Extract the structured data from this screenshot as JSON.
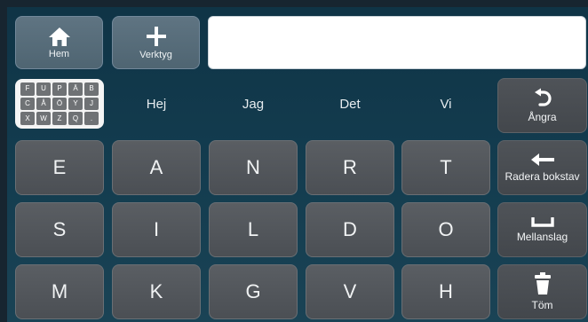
{
  "toolbar": {
    "home_label": "Hem",
    "tools_label": "Verktyg"
  },
  "message_field": {
    "value": ""
  },
  "keyboard_selector": {
    "letters": [
      "F",
      "U",
      "P",
      "Ä",
      "B",
      "C",
      "Å",
      "Ö",
      "Y",
      "J",
      "X",
      "W",
      "Z",
      "Q",
      "."
    ]
  },
  "suggestions": [
    "Hej",
    "Jag",
    "Det",
    "Vi"
  ],
  "keys": {
    "rows": [
      [
        "E",
        "A",
        "N",
        "R",
        "T"
      ],
      [
        "S",
        "I",
        "L",
        "D",
        "O"
      ],
      [
        "M",
        "K",
        "G",
        "V",
        "H"
      ]
    ]
  },
  "actions": {
    "undo_label": "Ångra",
    "backspace_label": "Radera bokstav",
    "space_label": "Mellanslag",
    "clear_label": "Töm"
  },
  "colors": {
    "background": "#133c4f",
    "key": "#54585d",
    "top_button": "#5a6f7c",
    "text_field": "#ffffff"
  }
}
